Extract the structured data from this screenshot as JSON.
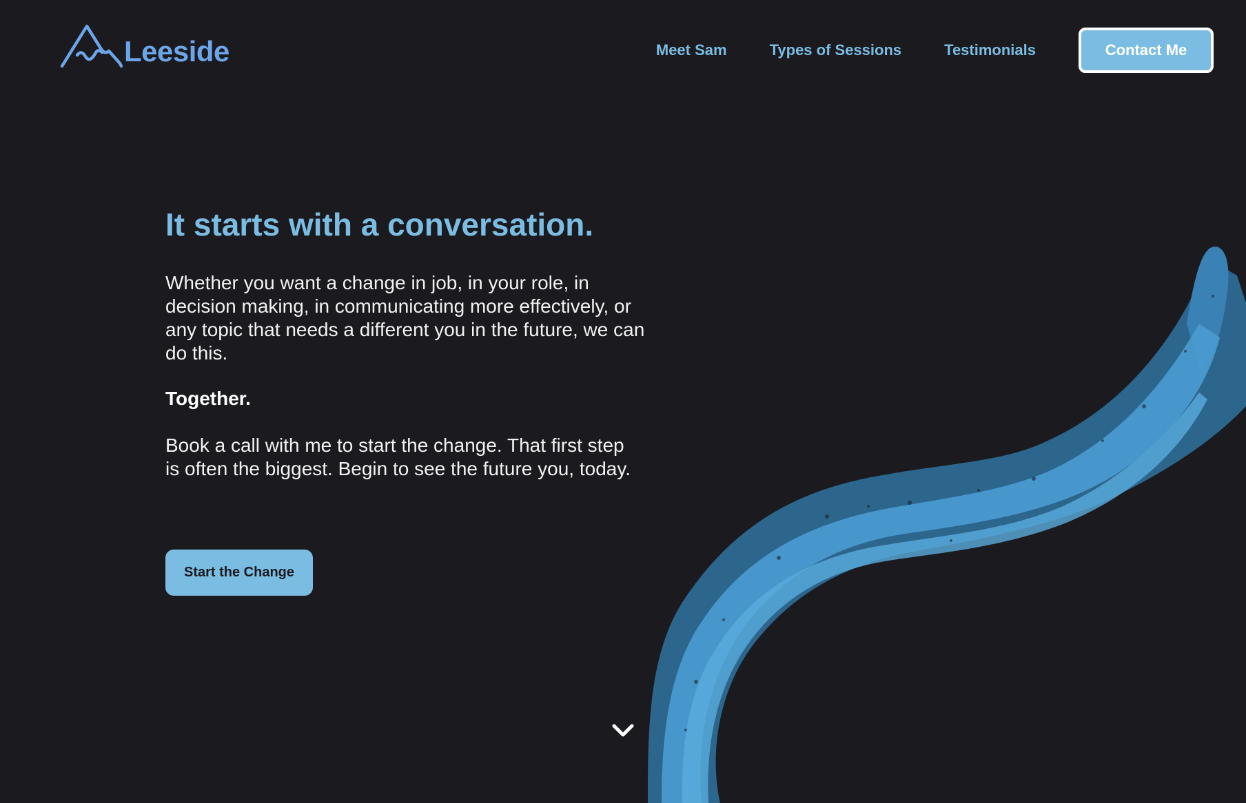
{
  "brand": {
    "name": "Leeside",
    "icon": "mountain-logo-icon",
    "color": "#6ca5e8"
  },
  "nav": {
    "links": [
      "Meet Sam",
      "Types of Sessions",
      "Testimonials"
    ],
    "contact_label": "Contact Me"
  },
  "hero": {
    "title": "It starts with a conversation.",
    "paragraph1": "Whether you want a change in job, in your role, in decision making, in communicating more effectively, or any topic that needs a different you in the future, we can do this.",
    "emphasis": "Together.",
    "paragraph2": "Book a call with me to start the change. That first step is often the biggest. Begin to see the future you, today.",
    "cta_label": "Start the Change"
  },
  "decor": {
    "scroll_icon": "chevron-down-icon",
    "stroke": "brush-stroke-decoration"
  },
  "colors": {
    "background": "#1a1a1f",
    "accent": "#7bbde2",
    "text": "#f2f2f2",
    "stroke_dark": "#2f6f99",
    "stroke_light": "#4a9ad0"
  }
}
